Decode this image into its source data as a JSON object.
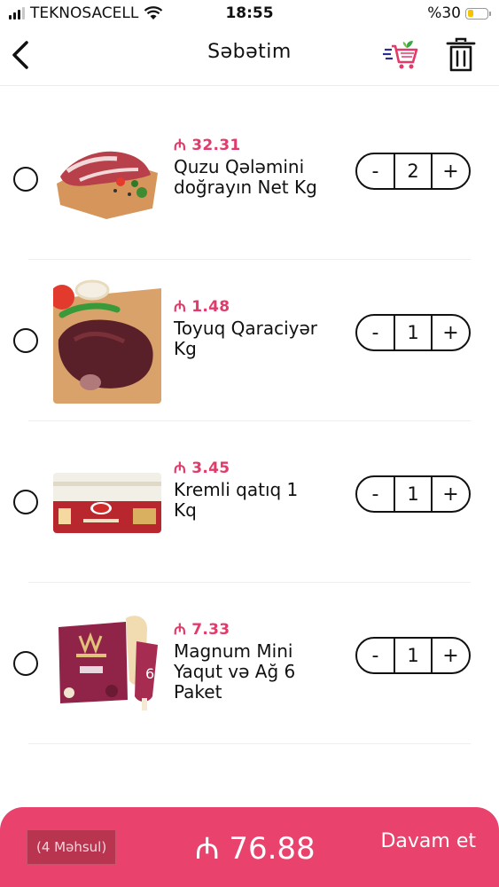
{
  "status_bar": {
    "carrier": "TEKNOSACELL",
    "time": "18:55",
    "battery_text": "%30",
    "battery_level": 0.3
  },
  "header": {
    "title": "Səbətim",
    "back_icon": "chevron-left-icon",
    "cart_icon": "cart-icon",
    "trash_icon": "trash-icon"
  },
  "currency_symbol": "₼",
  "items": [
    {
      "price": "₼ 32.31",
      "name": "Quzu Qələmini doğrayın Net Kg",
      "quantity": "2",
      "image": "lamb-meat-on-board"
    },
    {
      "price": "₼ 1.48",
      "name": "Toyuq Qaraciyər Kg",
      "quantity": "1",
      "image": "chicken-liver"
    },
    {
      "price": "₼ 3.45",
      "name": "Kremli qatıq 1 Kq",
      "quantity": "1",
      "image": "yogurt-tub"
    },
    {
      "price": "₼ 7.33",
      "name": "Magnum Mini Yaqut və Ağ 6 Paket",
      "quantity": "1",
      "image": "magnum-ice-cream-box"
    }
  ],
  "stepper": {
    "minus": "-",
    "plus": "+"
  },
  "footer": {
    "count_label": "(4 Məhsul)",
    "total": "₼ 76.88",
    "continue_label": "Davam et"
  },
  "colors": {
    "accent": "#e8426d",
    "price": "#e23a6b"
  }
}
